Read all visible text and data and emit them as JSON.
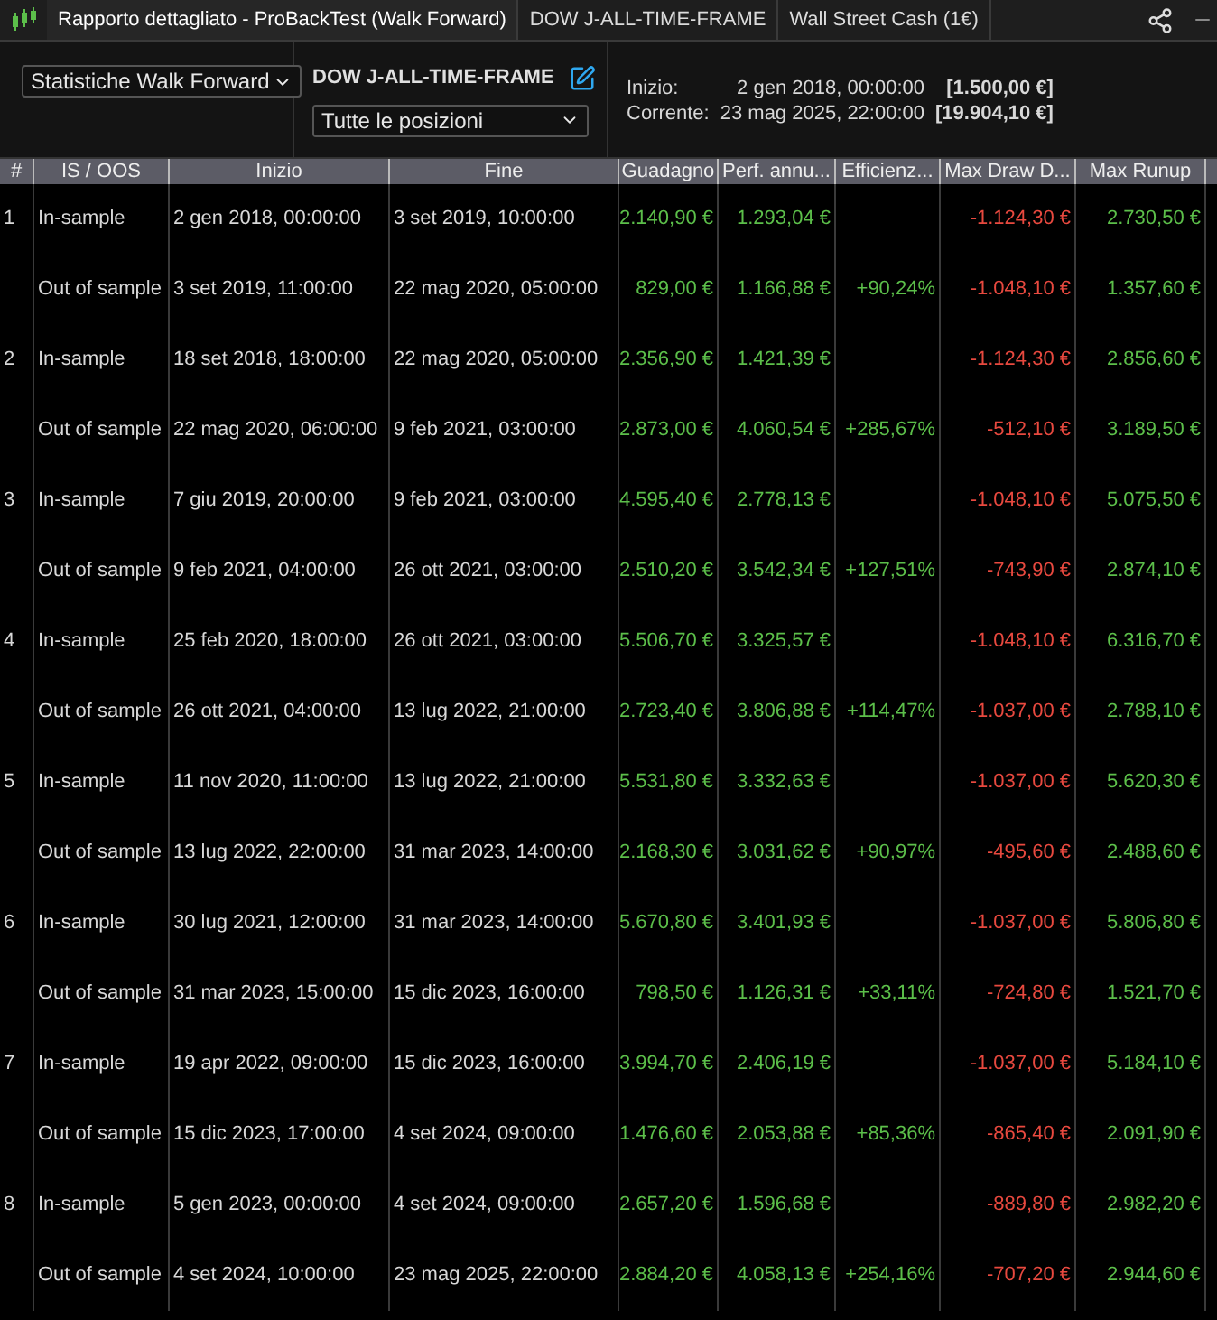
{
  "window": {
    "tabs": [
      {
        "label": "Rapporto dettagliato - ProBackTest (Walk Forward)",
        "selected": true
      },
      {
        "label": "DOW J-ALL-TIME-FRAME",
        "selected": false
      },
      {
        "label": "Wall Street Cash (1€)",
        "selected": false
      }
    ]
  },
  "toolbar": {
    "view_select": "Statistiche Walk Forward",
    "strategy_name": "DOW J-ALL-TIME-FRAME",
    "positions_select": "Tutte le posizioni",
    "start_label": "Inizio:",
    "start_value": "2 gen 2018, 00:00:00",
    "start_amount": "[1.500,00 €]",
    "current_label": "Corrente:",
    "current_value": "23 mag 2025, 22:00:00",
    "current_amount": "[19.904,10 €]"
  },
  "table": {
    "columns": [
      "#",
      "IS / OOS",
      "Inizio",
      "Fine",
      "Guadagno",
      "Perf. annu...",
      "Efficienz...",
      "Max Draw D...",
      "Max Runup"
    ],
    "rows": [
      {
        "num": "1",
        "type": "In-sample",
        "start": "2 gen 2018, 00:00:00",
        "end": "3 set 2019, 10:00:00",
        "gain": "2.140,90 €",
        "perf": "1.293,04 €",
        "drawdown": "-1.124,30 €",
        "runup": "2.730,50 €"
      },
      {
        "type": "Out of sample",
        "start": "3 set 2019, 11:00:00",
        "end": "22 mag 2020, 05:00:00",
        "gain": "829,00 €",
        "perf": "1.166,88 €",
        "eff": "+90,24%",
        "drawdown": "-1.048,10 €",
        "runup": "1.357,60 €"
      },
      {
        "num": "2",
        "type": "In-sample",
        "start": "18 set 2018, 18:00:00",
        "end": "22 mag 2020, 05:00:00",
        "gain": "2.356,90 €",
        "perf": "1.421,39 €",
        "drawdown": "-1.124,30 €",
        "runup": "2.856,60 €"
      },
      {
        "type": "Out of sample",
        "start": "22 mag 2020, 06:00:00",
        "end": "9 feb 2021, 03:00:00",
        "gain": "2.873,00 €",
        "perf": "4.060,54 €",
        "eff": "+285,67%",
        "drawdown": "-512,10 €",
        "runup": "3.189,50 €"
      },
      {
        "num": "3",
        "type": "In-sample",
        "start": "7 giu 2019, 20:00:00",
        "end": "9 feb 2021, 03:00:00",
        "gain": "4.595,40 €",
        "perf": "2.778,13 €",
        "drawdown": "-1.048,10 €",
        "runup": "5.075,50 €"
      },
      {
        "type": "Out of sample",
        "start": "9 feb 2021, 04:00:00",
        "end": "26 ott 2021, 03:00:00",
        "gain": "2.510,20 €",
        "perf": "3.542,34 €",
        "eff": "+127,51%",
        "drawdown": "-743,90 €",
        "runup": "2.874,10 €"
      },
      {
        "num": "4",
        "type": "In-sample",
        "start": "25 feb 2020, 18:00:00",
        "end": "26 ott 2021, 03:00:00",
        "gain": "5.506,70 €",
        "perf": "3.325,57 €",
        "drawdown": "-1.048,10 €",
        "runup": "6.316,70 €"
      },
      {
        "type": "Out of sample",
        "start": "26 ott 2021, 04:00:00",
        "end": "13 lug 2022, 21:00:00",
        "gain": "2.723,40 €",
        "perf": "3.806,88 €",
        "eff": "+114,47%",
        "drawdown": "-1.037,00 €",
        "runup": "2.788,10 €"
      },
      {
        "num": "5",
        "type": "In-sample",
        "start": "11 nov 2020, 11:00:00",
        "end": "13 lug 2022, 21:00:00",
        "gain": "5.531,80 €",
        "perf": "3.332,63 €",
        "drawdown": "-1.037,00 €",
        "runup": "5.620,30 €"
      },
      {
        "type": "Out of sample",
        "start": "13 lug 2022, 22:00:00",
        "end": "31 mar 2023, 14:00:00",
        "gain": "2.168,30 €",
        "perf": "3.031,62 €",
        "eff": "+90,97%",
        "drawdown": "-495,60 €",
        "runup": "2.488,60 €"
      },
      {
        "num": "6",
        "type": "In-sample",
        "start": "30 lug 2021, 12:00:00",
        "end": "31 mar 2023, 14:00:00",
        "gain": "5.670,80 €",
        "perf": "3.401,93 €",
        "drawdown": "-1.037,00 €",
        "runup": "5.806,80 €"
      },
      {
        "type": "Out of sample",
        "start": "31 mar 2023, 15:00:00",
        "end": "15 dic 2023, 16:00:00",
        "gain": "798,50 €",
        "perf": "1.126,31 €",
        "eff": "+33,11%",
        "drawdown": "-724,80 €",
        "runup": "1.521,70 €"
      },
      {
        "num": "7",
        "type": "In-sample",
        "start": "19 apr 2022, 09:00:00",
        "end": "15 dic 2023, 16:00:00",
        "gain": "3.994,70 €",
        "perf": "2.406,19 €",
        "drawdown": "-1.037,00 €",
        "runup": "5.184,10 €"
      },
      {
        "type": "Out of sample",
        "start": "15 dic 2023, 17:00:00",
        "end": "4 set 2024, 09:00:00",
        "gain": "1.476,60 €",
        "perf": "2.053,88 €",
        "eff": "+85,36%",
        "drawdown": "-865,40 €",
        "runup": "2.091,90 €"
      },
      {
        "num": "8",
        "type": "In-sample",
        "start": "5 gen 2023, 00:00:00",
        "end": "4 set 2024, 09:00:00",
        "gain": "2.657,20 €",
        "perf": "1.596,68 €",
        "drawdown": "-889,80 €",
        "runup": "2.982,20 €"
      },
      {
        "type": "Out of sample",
        "start": "4 set 2024, 10:00:00",
        "end": "23 mag 2025, 22:00:00",
        "gain": "2.884,20 €",
        "perf": "4.058,13 €",
        "eff": "+254,16%",
        "drawdown": "-707,20 €",
        "runup": "2.944,60 €"
      }
    ]
  }
}
